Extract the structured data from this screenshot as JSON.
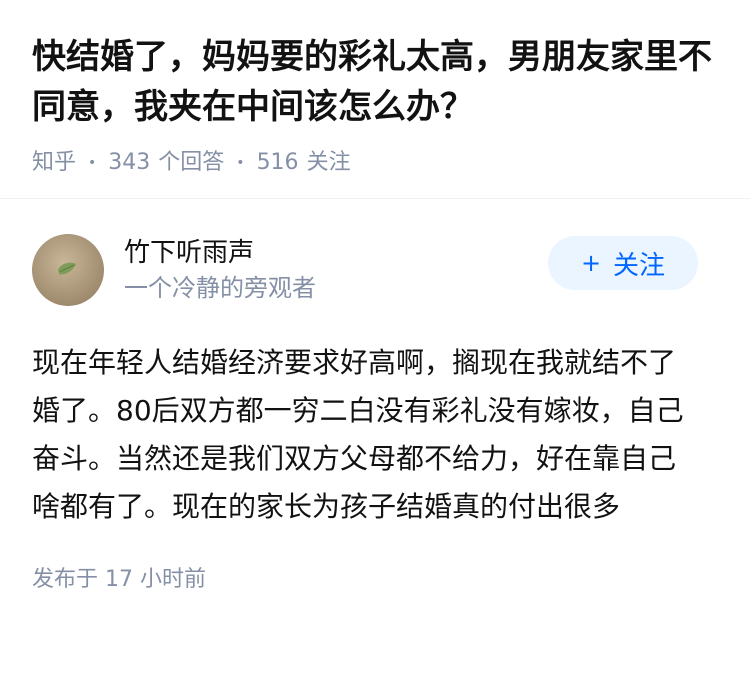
{
  "question": {
    "title": "快结婚了，妈妈要的彩礼太高，男朋友家里不同意，我夹在中间该怎么办？",
    "source": "知乎",
    "answer_count": "343",
    "answer_label": "个回答",
    "follower_count": "516",
    "follower_label": "关注"
  },
  "answer": {
    "author_name": "竹下听雨声",
    "author_bio": "一个冷静的旁观者",
    "follow_label": "关注",
    "follow_plus": "+",
    "content": "现在年轻人结婚经济要求好高啊，搁现在我就结不了婚了。80后双方都一穷二白没有彩礼没有嫁妆，自己奋斗。当然还是我们双方父母都不给力，好在靠自己啥都有了。现在的家长为孩子结婚真的付出很多",
    "publish_prefix": "发布于",
    "publish_time": "17 小时前"
  },
  "icons": {
    "avatar": "leaf-avatar-icon",
    "follow": "plus-icon"
  },
  "colors": {
    "accent": "#0066ff",
    "follow_bg": "#ebf5ff",
    "meta_gray": "#8590a6",
    "text": "#121212"
  }
}
